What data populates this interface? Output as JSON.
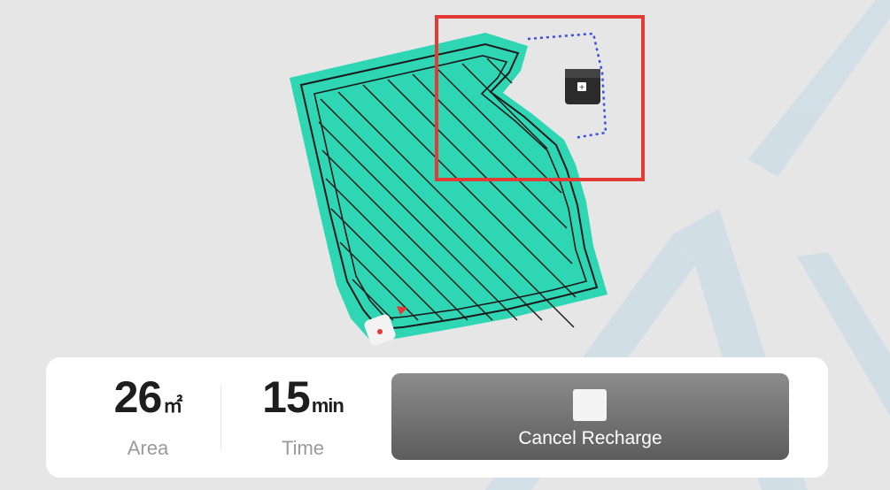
{
  "colors": {
    "mow_area": "#2ed6b4",
    "mow_lines": "#1a1a1a",
    "highlight_box": "#e53935",
    "dotted_path": "#3a4ee0",
    "button_bg": "#6e6e6e",
    "watermark": "#c9dbe6"
  },
  "map": {
    "icons": [
      "charging-station-icon",
      "mower-icon",
      "red-arrow-marker-icon"
    ]
  },
  "stats": {
    "area": {
      "value": "26",
      "unit": "㎡",
      "label": "Area"
    },
    "time": {
      "value": "15",
      "unit": "min",
      "label": "Time"
    }
  },
  "actions": {
    "cancel_recharge": {
      "label": "Cancel Recharge",
      "icon": "stop-icon"
    }
  }
}
